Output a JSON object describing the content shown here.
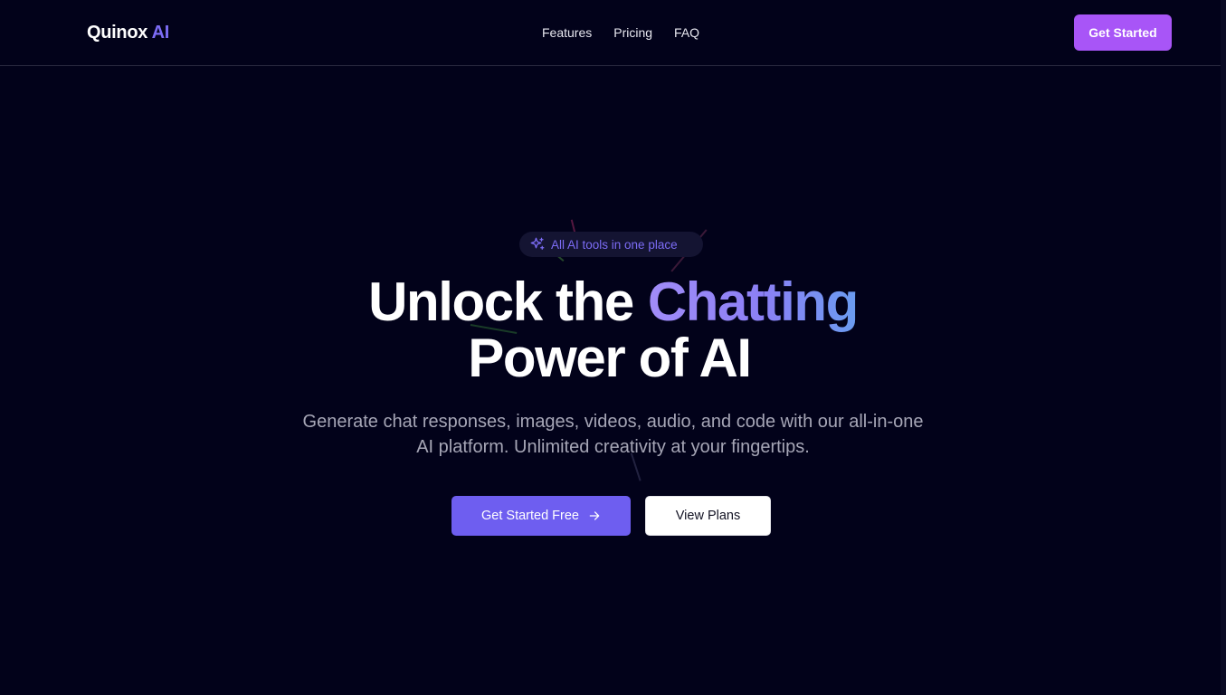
{
  "nav": {
    "logo_main": "Quinox",
    "logo_accent": "AI",
    "links": [
      "Features",
      "Pricing",
      "FAQ"
    ],
    "cta_label": "Get Started"
  },
  "hero": {
    "badge_icon": "sparkles-icon",
    "badge_text": "All AI tools in one place",
    "title_part1": "Unlock the",
    "title_highlight": "Chatting",
    "title_line2": "Power of AI",
    "subtitle": "Generate chat responses, images, videos, audio, and code with our all-in-one AI platform. Unlimited creativity at your fingertips.",
    "primary_button": "Get Started Free",
    "primary_button_icon": "arrow-right-icon",
    "secondary_button": "View Plans"
  },
  "colors": {
    "background": "#02021a",
    "accent": "#7c6cf5",
    "nav_cta": "#a855f7",
    "primary_button": "#6e5ef0"
  }
}
